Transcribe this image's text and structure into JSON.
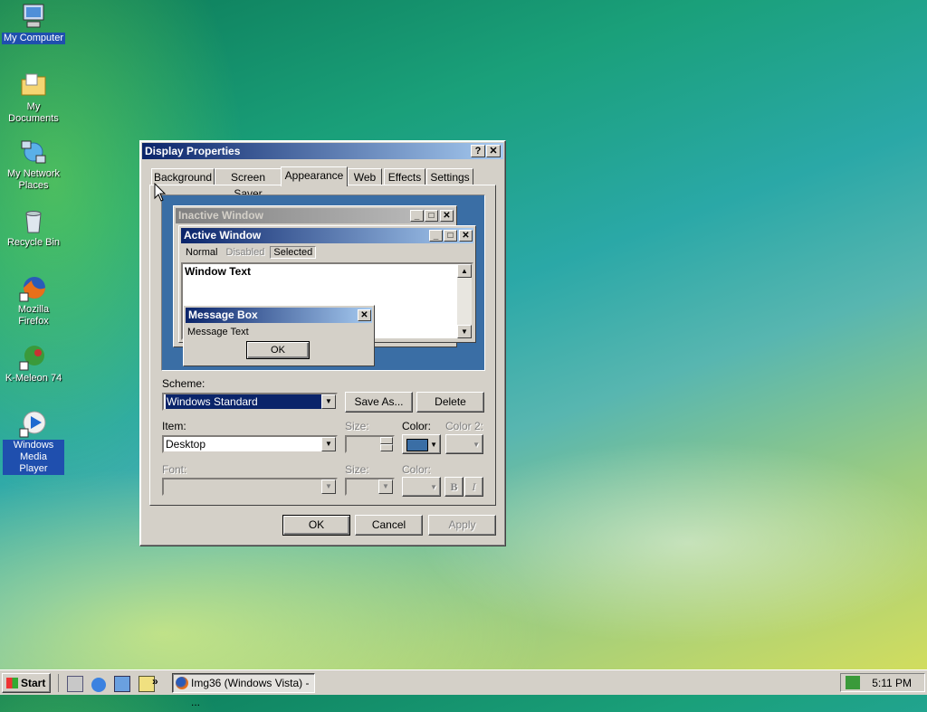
{
  "desktop": {
    "icons": [
      {
        "label": "My Computer"
      },
      {
        "label": "My Documents"
      },
      {
        "label": "My Network Places"
      },
      {
        "label": "Recycle Bin"
      },
      {
        "label": "Mozilla Firefox"
      },
      {
        "label": "K-Meleon 74"
      },
      {
        "label": "Windows Media Player"
      }
    ]
  },
  "dialog": {
    "title": "Display Properties",
    "help_glyph": "?",
    "close_glyph": "✕",
    "tabs": [
      "Background",
      "Screen Saver",
      "Appearance",
      "Web",
      "Effects",
      "Settings"
    ],
    "active_tab": "Appearance",
    "preview": {
      "inactive_title": "Inactive Window",
      "active_title": "Active Window",
      "menu": [
        "Normal",
        "Disabled",
        "Selected"
      ],
      "window_text": "Window Text",
      "msgbox_title": "Message Box",
      "msgbox_text": "Message Text",
      "msgbox_ok": "OK"
    },
    "scheme_label": "Scheme:",
    "scheme_value": "Windows Standard",
    "save_as": "Save As...",
    "delete": "Delete",
    "item_label": "Item:",
    "item_value": "Desktop",
    "size_label": "Size:",
    "color_label": "Color:",
    "color2_label": "Color 2:",
    "font_label": "Font:",
    "font_size_label": "Size:",
    "font_color_label": "Color:",
    "bold": "B",
    "italic": "I",
    "item_color": "#3a6ea5",
    "ok": "OK",
    "cancel": "Cancel",
    "apply": "Apply"
  },
  "taskbar": {
    "start": "Start",
    "quick_launch": [
      "desktop-icon",
      "ie-icon",
      "outlook-icon",
      "search-icon"
    ],
    "chevron": "»",
    "task": "Img36 (Windows Vista) - ...",
    "clock": "5:11 PM"
  }
}
